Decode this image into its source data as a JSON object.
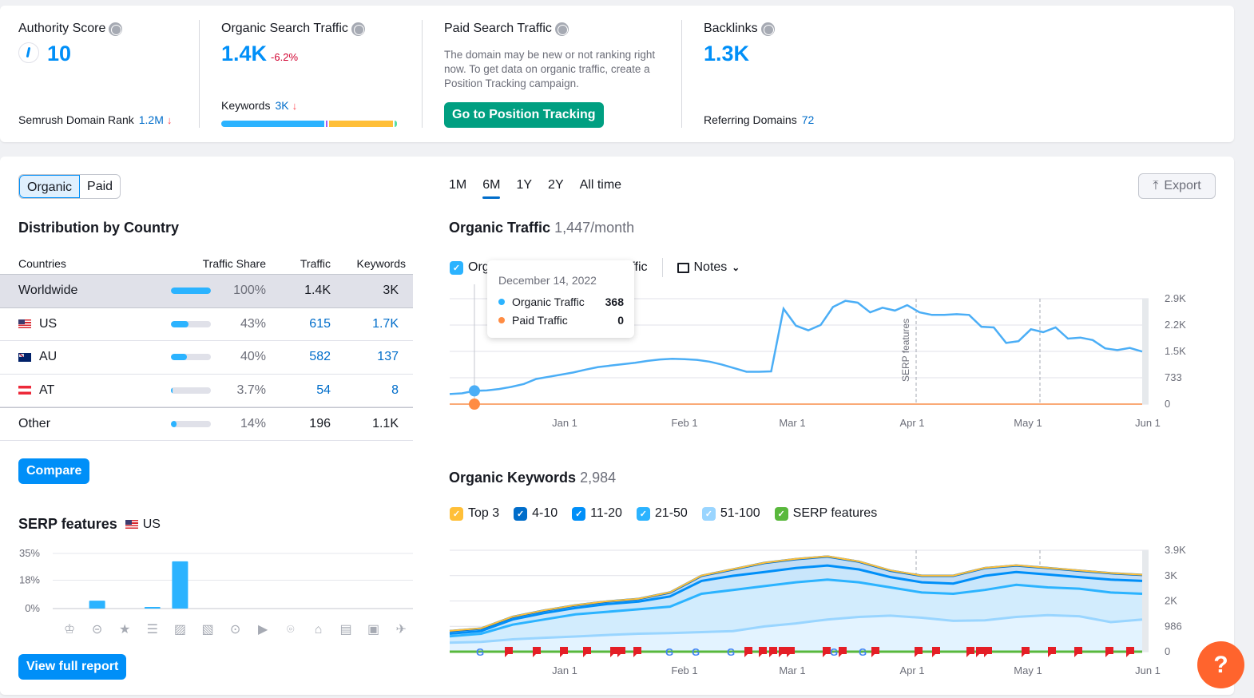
{
  "metrics": {
    "authority": {
      "title": "Authority Score",
      "value": "10",
      "sub_label": "Semrush Domain Rank",
      "sub_value": "1.2M",
      "sub_trend": "down"
    },
    "organic": {
      "title": "Organic Search Traffic",
      "value": "1.4K",
      "change": "-6.2%",
      "sub_label": "Keywords",
      "sub_value": "3K",
      "sub_trend": "down",
      "keyword_bar": [
        {
          "color": "#2bb3ff",
          "share": 0.59
        },
        {
          "color": "#a75cf2",
          "share": 0.01
        },
        {
          "color": "#ffbf38",
          "share": 0.37
        },
        {
          "color": "#59dda5",
          "share": 0.01
        }
      ]
    },
    "paid": {
      "title": "Paid Search Traffic",
      "description": "The domain may be new or not ranking right now. To get data on organic traffic, create a Position Tracking campaign.",
      "button": "Go to Position Tracking"
    },
    "backlinks": {
      "title": "Backlinks",
      "value": "1.3K",
      "sub_label": "Referring Domains",
      "sub_value": "72"
    }
  },
  "toggle": {
    "options": [
      "Organic",
      "Paid"
    ],
    "selected": "Organic"
  },
  "distribution": {
    "title": "Distribution by Country",
    "columns": [
      "Countries",
      "Traffic Share",
      "Traffic",
      "Keywords"
    ],
    "rows": [
      {
        "country": "Worldwide",
        "flag": "",
        "share": 100,
        "share_label": "100%",
        "traffic": "1.4K",
        "keywords": "3K"
      },
      {
        "country": "US",
        "flag": "us",
        "share": 43,
        "share_label": "43%",
        "traffic": "615",
        "keywords": "1.7K"
      },
      {
        "country": "AU",
        "flag": "au",
        "share": 40,
        "share_label": "40%",
        "traffic": "582",
        "keywords": "137"
      },
      {
        "country": "AT",
        "flag": "at",
        "share": 3.7,
        "share_label": "3.7%",
        "traffic": "54",
        "keywords": "8"
      },
      {
        "country": "Other",
        "flag": "",
        "share": 14,
        "share_label": "14%",
        "traffic": "196",
        "keywords": "1.1K"
      }
    ],
    "compare_button": "Compare"
  },
  "serp": {
    "title": "SERP features",
    "country": "US",
    "y_ticks": [
      "35%",
      "18%",
      "0%"
    ],
    "features": [
      {
        "icon": "crown-icon",
        "glyph": "♔",
        "value": 0
      },
      {
        "icon": "link-icon",
        "glyph": "⊝",
        "value": 5
      },
      {
        "icon": "star-icon",
        "glyph": "★",
        "value": 0
      },
      {
        "icon": "featured-snippet-icon",
        "glyph": "☰",
        "value": 1
      },
      {
        "icon": "image-icon",
        "glyph": "▨",
        "value": 30
      },
      {
        "icon": "image-pack-icon",
        "glyph": "▧",
        "value": 0
      },
      {
        "icon": "video-icon",
        "glyph": "⊙",
        "value": 0
      },
      {
        "icon": "video-carousel-icon",
        "glyph": "▶",
        "value": 0
      },
      {
        "icon": "local-pack-icon",
        "glyph": "⌾",
        "value": 0
      },
      {
        "icon": "knowledge-icon",
        "glyph": "⌂",
        "value": 0
      },
      {
        "icon": "news-icon",
        "glyph": "▤",
        "value": 0
      },
      {
        "icon": "jobs-icon",
        "glyph": "▣",
        "value": 0
      },
      {
        "icon": "twitter-icon",
        "glyph": "✈",
        "value": 0
      }
    ],
    "y_max": 35,
    "button": "View full report"
  },
  "range_tabs": [
    "1M",
    "6M",
    "1Y",
    "2Y",
    "All time"
  ],
  "range_selected": "6M",
  "export_label": "Export",
  "traffic": {
    "title": "Organic Traffic",
    "subtitle": "1,447/month",
    "legend": [
      {
        "label": "Organic Traffic",
        "color": "#2bb3ff",
        "checked": true
      },
      {
        "label": "Paid Traffic",
        "color": "#ff8c43",
        "checked": true
      }
    ],
    "notes_label": "Notes",
    "tooltip": {
      "date": "December 14, 2022",
      "rows": [
        {
          "label": "Organic Traffic",
          "value": "368",
          "color": "#2bb3ff"
        },
        {
          "label": "Paid Traffic",
          "value": "0",
          "color": "#ff8c43"
        }
      ]
    }
  },
  "keywords": {
    "title": "Organic Keywords",
    "subtitle": "2,984",
    "legend": [
      {
        "label": "Top 3",
        "color": "#ffbf38"
      },
      {
        "label": "4-10",
        "color": "#006dca"
      },
      {
        "label": "11-20",
        "color": "#008ff8"
      },
      {
        "label": "21-50",
        "color": "#2bb3ff"
      },
      {
        "label": "51-100",
        "color": "#99d5ff"
      },
      {
        "label": "SERP features",
        "color": "#59b83c"
      }
    ]
  },
  "chart_data": [
    {
      "type": "line",
      "title": "Organic Traffic 1,447/month",
      "x_ticks": [
        "Jan 1",
        "Feb 1",
        "Mar 1",
        "Apr 1",
        "May 1",
        "Jun 1"
      ],
      "y_ticks": [
        "0",
        "733",
        "1.5K",
        "2.2K",
        "2.9K"
      ],
      "ylim": [
        0,
        2930
      ],
      "annotation": "SERP features",
      "series": [
        {
          "name": "Organic Traffic",
          "color": "#2bb3ff",
          "values": [
            280,
            300,
            368,
            380,
            420,
            480,
            560,
            700,
            760,
            820,
            880,
            960,
            1030,
            1070,
            1110,
            1150,
            1200,
            1240,
            1260,
            1250,
            1230,
            1180,
            1100,
            1000,
            900,
            900,
            910,
            2650,
            2180,
            2050,
            2200,
            2700,
            2870,
            2820,
            2550,
            2680,
            2600,
            2750,
            2550,
            2480,
            2480,
            2500,
            2480,
            2150,
            2130,
            1700,
            1750,
            2080,
            2000,
            2130,
            1820,
            1850,
            1780,
            1550,
            1500,
            1560,
            1460
          ]
        },
        {
          "name": "Paid Traffic",
          "color": "#ff8c43",
          "values": [
            0
          ]
        }
      ]
    },
    {
      "type": "area",
      "title": "Organic Keywords 2,984",
      "x_ticks": [
        "Jan 1",
        "Feb 1",
        "Mar 1",
        "Apr 1",
        "May 1",
        "Jun 1"
      ],
      "y_ticks": [
        "0",
        "986",
        "2K",
        "3K",
        "3.9K"
      ],
      "ylim": [
        0,
        3944
      ],
      "series": [
        {
          "name": "51-100",
          "color": "#99d5ff",
          "values": [
            350,
            380,
            480,
            540,
            590,
            650,
            700,
            720,
            760,
            800,
            980,
            1100,
            1250,
            1350,
            1400,
            1320,
            1200,
            1220,
            1350,
            1420,
            1380,
            1150,
            1250
          ]
        },
        {
          "name": "21-50",
          "color": "#2bb3ff",
          "values": [
            600,
            700,
            1050,
            1250,
            1450,
            1550,
            1650,
            1750,
            2250,
            2400,
            2550,
            2700,
            2800,
            2700,
            2500,
            2300,
            2250,
            2400,
            2600,
            2500,
            2450,
            2300,
            2250
          ]
        },
        {
          "name": "11-20",
          "color": "#008ff8",
          "values": [
            700,
            800,
            1250,
            1500,
            1700,
            1850,
            1950,
            2150,
            2750,
            2950,
            3100,
            3250,
            3350,
            3200,
            2900,
            2700,
            2650,
            2950,
            3100,
            3000,
            2900,
            2800,
            2750
          ]
        },
        {
          "name": "4-10",
          "color": "#006dca",
          "values": [
            800,
            900,
            1350,
            1600,
            1800,
            1950,
            2050,
            2300,
            2950,
            3200,
            3450,
            3600,
            3700,
            3500,
            3150,
            2950,
            2950,
            3250,
            3350,
            3250,
            3150,
            3050,
            2984
          ]
        },
        {
          "name": "Top 3",
          "color": "#ffbf38",
          "values": [
            810,
            910,
            1360,
            1610,
            1810,
            1960,
            2060,
            2310,
            2960,
            3210,
            3460,
            3610,
            3710,
            3510,
            3160,
            2960,
            2960,
            3260,
            3360,
            3260,
            3160,
            3060,
            2994
          ]
        }
      ]
    },
    {
      "type": "bar",
      "title": "SERP features US",
      "categories": [
        "crown",
        "link",
        "star",
        "featured-snippet",
        "image",
        "image-pack",
        "video",
        "video-carousel",
        "local-pack",
        "knowledge",
        "news",
        "jobs",
        "twitter"
      ],
      "values": [
        0,
        5,
        0,
        1,
        30,
        0,
        0,
        0,
        0,
        0,
        0,
        0,
        0
      ],
      "y_ticks": [
        "0%",
        "18%",
        "35%"
      ],
      "ylim": [
        0,
        35
      ]
    }
  ]
}
